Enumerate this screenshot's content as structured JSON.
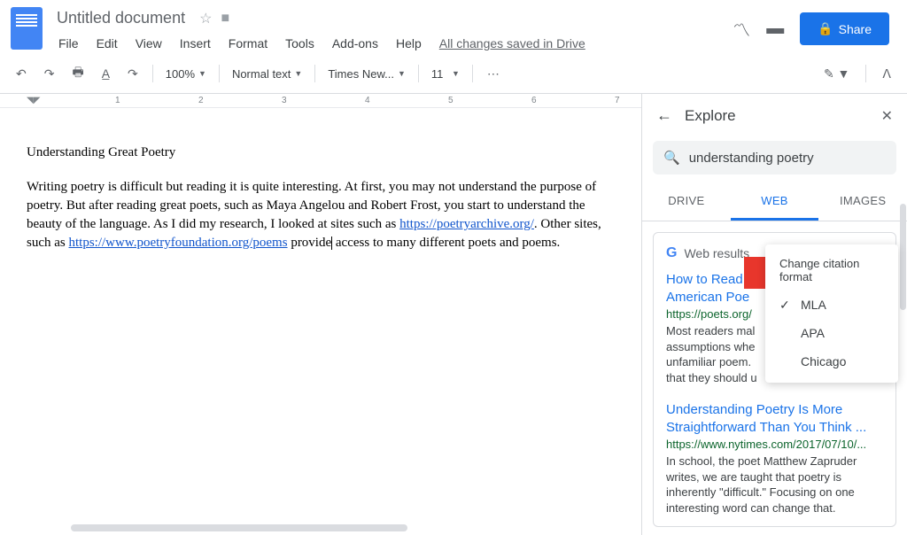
{
  "header": {
    "title": "Untitled document",
    "menus": [
      "File",
      "Edit",
      "View",
      "Insert",
      "Format",
      "Tools",
      "Add-ons",
      "Help"
    ],
    "save_status": "All changes saved in Drive",
    "share_label": "Share"
  },
  "toolbar": {
    "zoom": "100%",
    "style": "Normal text",
    "font": "Times New...",
    "font_size": "11"
  },
  "ruler": {
    "marks": [
      "1",
      "2",
      "3",
      "4",
      "5",
      "6",
      "7"
    ]
  },
  "document": {
    "heading": "Understanding Great Poetry",
    "p1a": "Writing poetry is difficult but reading it is quite interesting. At first, you may not understand the purpose of poetry. But after reading great poets, such as Maya Angelou and Robert Frost, you start to understand the beauty of the language. As I did my research, I looked at sites such as ",
    "link1": "https://poetryarchive.org/",
    "p1b": ". Other sites, such as ",
    "link2": "https://www.poetryfoundation.org/poems",
    "p1c_before_cursor": " provide",
    "p1c_after_cursor": " access to many different poets and poems."
  },
  "explore": {
    "title": "Explore",
    "query": "understanding poetry",
    "tabs": {
      "drive": "DRIVE",
      "web": "WEB",
      "images": "IMAGES"
    },
    "results_label": "Web results",
    "citation_menu": {
      "header": "Change citation format",
      "options": [
        "MLA",
        "APA",
        "Chicago"
      ],
      "selected": "MLA"
    },
    "results": [
      {
        "title": "How to Read a Poem | Academy of American Poets",
        "title_truncated_a": "How to Read a",
        "title_truncated_b": "American Poe",
        "url": "https://poets.org/",
        "snippet_trunc": "Most readers mal\nassumptions whe\nunfamiliar poem.\nthat they should u"
      },
      {
        "title": "Understanding Poetry Is More Straightforward Than You Think ...",
        "url": "https://www.nytimes.com/2017/07/10/...",
        "snippet": "In school, the poet Matthew Zapruder writes, we are taught that poetry is inherently \"difficult.\" Focusing on one interesting word can change that."
      }
    ]
  }
}
